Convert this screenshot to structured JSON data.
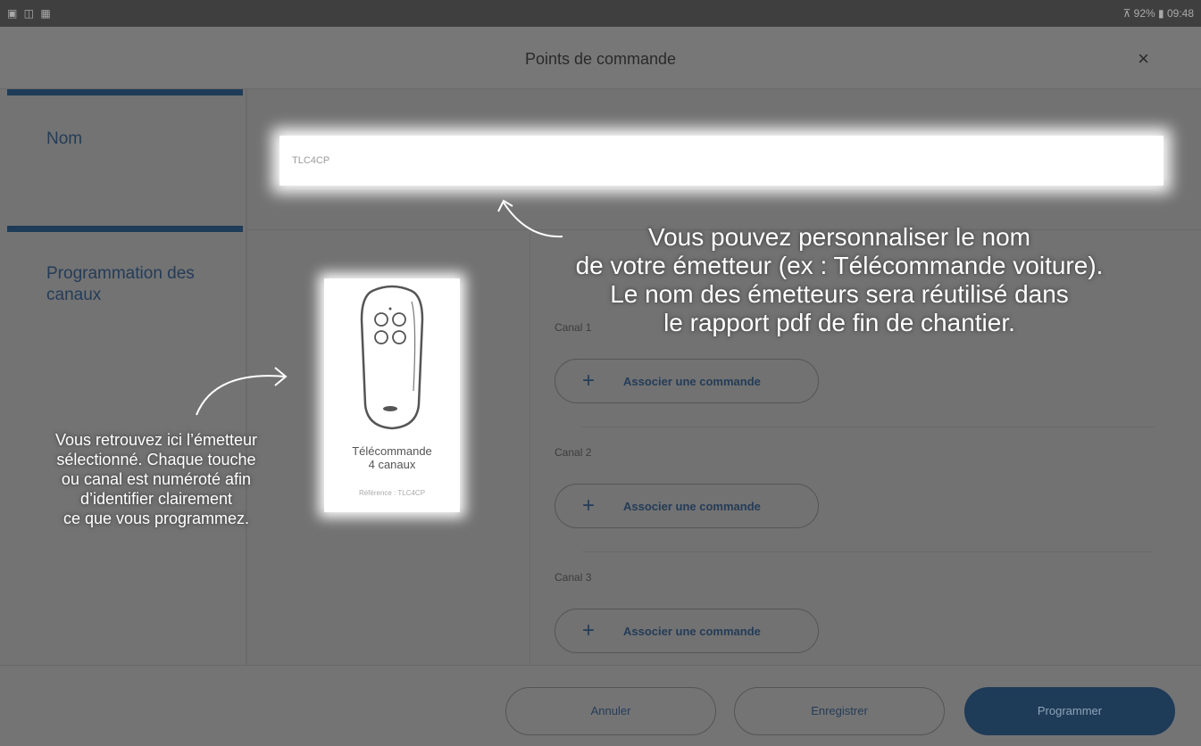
{
  "status_bar": {
    "left_icons": "▣ ◫ ▦",
    "right": "⊼ 92% ▮ 09:48"
  },
  "header": {
    "title": "Points de commande",
    "close_label": "×"
  },
  "sidebar": {
    "items": [
      {
        "label": "Nom"
      },
      {
        "label": "Programmation des canaux"
      }
    ]
  },
  "name_field": {
    "value": "TLC4CP"
  },
  "device": {
    "name_line1": "Télécommande",
    "name_line2": "4 canaux",
    "reference": "Référence : TLC4CP",
    "icon": "remote-control-icon"
  },
  "channels": [
    {
      "label": "Canal 1",
      "button": "Associer une commande"
    },
    {
      "label": "Canal 2",
      "button": "Associer une commande"
    },
    {
      "label": "Canal 3",
      "button": "Associer une commande"
    }
  ],
  "footer": {
    "cancel": "Annuler",
    "save": "Enregistrer",
    "program": "Programmer"
  },
  "annotations": {
    "right": [
      "Vous pouvez personnaliser le nom",
      "de votre émetteur (ex : Télécommande voiture).",
      "Le nom des émetteurs sera réutilisé dans",
      "le rapport pdf de fin de chantier."
    ],
    "left": [
      "Vous retrouvez ici l’émetteur",
      "sélectionné. Chaque touche",
      "ou canal est numéroté afin",
      "d’identifier clairement",
      "ce que vous programmez."
    ]
  },
  "colors": {
    "accent": "#1e3b58",
    "overlay": "#727272"
  }
}
